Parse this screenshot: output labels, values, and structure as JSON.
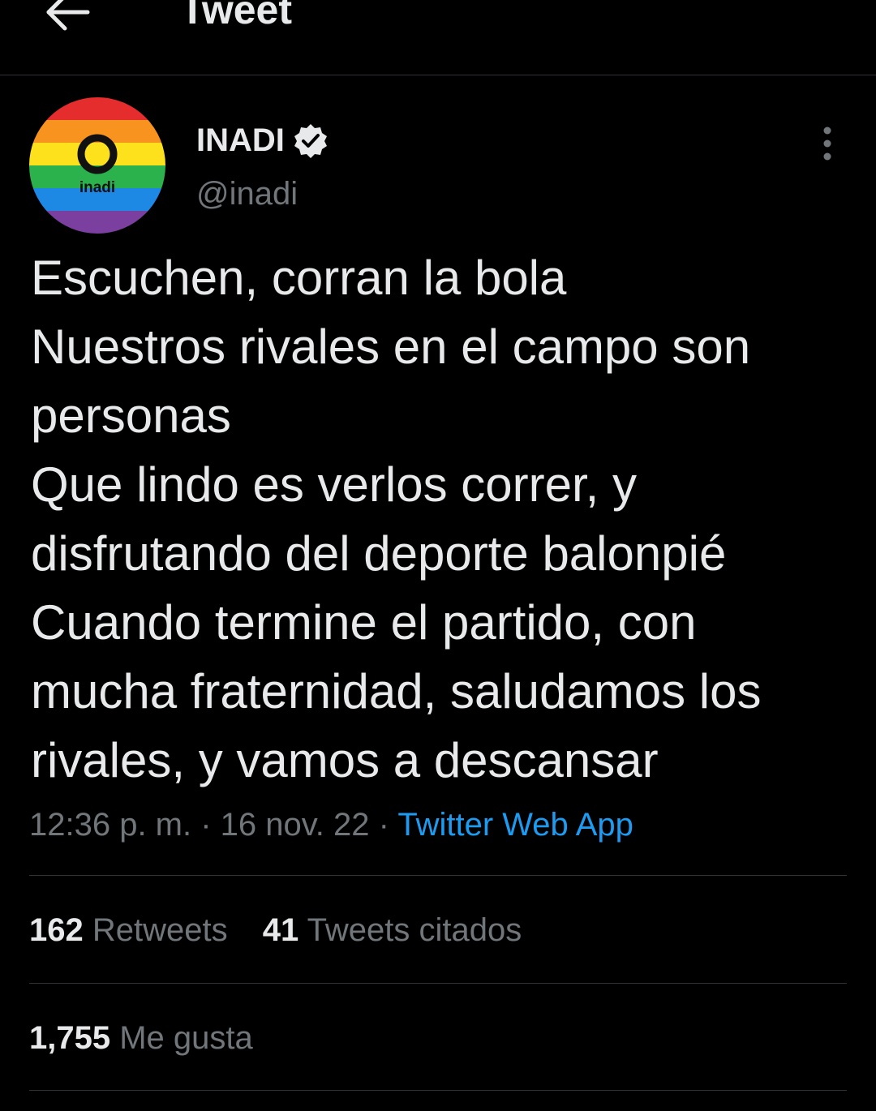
{
  "header": {
    "title": "Tweet",
    "back_icon": "arrow-left-icon"
  },
  "author": {
    "display_name": "INADI",
    "handle": "@inadi",
    "avatar_text": "inadi",
    "verified_icon": "verified-badge-icon"
  },
  "tweet": {
    "lines": "Escuchen, corran la bola\nNuestros rivales en el campo son\npersonas\nQue lindo es verlos correr, y\ndisfrutando del deporte balonpié\nCuando termine el partido, con\nmucha fraternidad, saludamos los\nrivales, y vamos a descansar"
  },
  "meta": {
    "time": "12:36 p. m.",
    "separator1": " · ",
    "date": "16 nov. 22",
    "separator2": " · ",
    "source": "Twitter Web App"
  },
  "stats": {
    "retweets_count": "162",
    "retweets_label": "Retweets",
    "quotes_count": "41",
    "quotes_label": "Tweets citados",
    "likes_count": "1,755",
    "likes_label": "Me gusta"
  },
  "colors": {
    "background": "#000000",
    "text": "#e7e9ea",
    "muted": "#71767b",
    "accent": "#1d9bf0",
    "divider": "#2f3336"
  }
}
